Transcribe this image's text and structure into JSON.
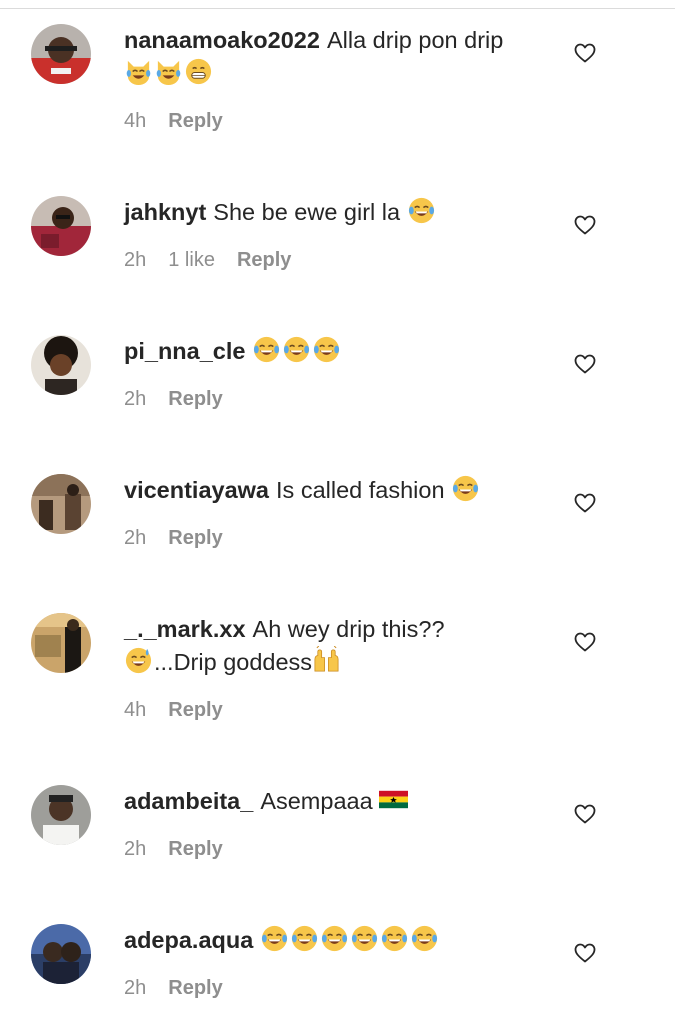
{
  "comments": [
    {
      "username": "nanaamoako2022",
      "text": "Alla drip pon drip",
      "emojis": [
        "cat-tears-icon",
        "cat-tears-icon",
        "grin-icon"
      ],
      "time": "4h",
      "likes": "",
      "reply": "Reply"
    },
    {
      "username": "jahknyt",
      "text": "She be ewe girl la",
      "emojis": [
        "tears-of-joy-icon"
      ],
      "time": "2h",
      "likes": "1 like",
      "reply": "Reply"
    },
    {
      "username": "pi_nna_cle",
      "text": "",
      "emojis": [
        "tears-of-joy-icon",
        "tears-of-joy-icon",
        "tears-of-joy-icon"
      ],
      "time": "2h",
      "likes": "",
      "reply": "Reply"
    },
    {
      "username": "vicentiayawa",
      "text": "Is called fashion",
      "emojis": [
        "tears-of-joy-icon"
      ],
      "time": "2h",
      "likes": "",
      "reply": "Reply"
    },
    {
      "username": "_._mark.xx",
      "text": "Ah wey drip this??",
      "text2": "...Drip goddess",
      "emojis": [
        "sweat-smile-icon"
      ],
      "emojis2": [
        "raised-hands-icon"
      ],
      "time": "4h",
      "likes": "",
      "reply": "Reply"
    },
    {
      "username": "adambeita_",
      "text": "Asempaaa",
      "emojis": [
        "ghana-flag-icon"
      ],
      "time": "2h",
      "likes": "",
      "reply": "Reply"
    },
    {
      "username": "adepa.aqua",
      "text": "",
      "emojis": [
        "tears-of-joy-icon",
        "tears-of-joy-icon",
        "tears-of-joy-icon",
        "tears-of-joy-icon",
        "tears-of-joy-icon",
        "tears-of-joy-icon"
      ],
      "time": "2h",
      "likes": "",
      "reply": "Reply"
    }
  ],
  "colors": {
    "text": "#262626",
    "meta": "#8e8e8e",
    "divider": "#dbdbdb"
  }
}
